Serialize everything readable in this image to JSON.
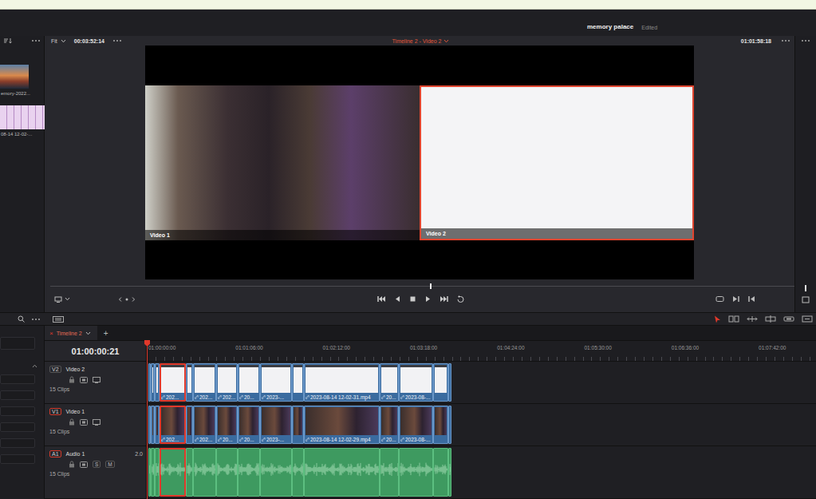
{
  "project": {
    "name": "memory palace",
    "status": "Edited"
  },
  "media_pool": {
    "items": [
      {
        "label": "emory-2022...",
        "kind": "photo"
      },
      {
        "label": "08-14 12-02-...",
        "kind": "screen"
      }
    ]
  },
  "viewer": {
    "zoom": "Fit",
    "source_timecode": "00:03:52:14",
    "title": "Timeline 2 - Video 2",
    "record_timecode": "01:01:58:18",
    "level": 0.51,
    "angles": [
      {
        "label": "Video 1",
        "kind": "camera",
        "selected": false
      },
      {
        "label": "Video 2",
        "kind": "screen",
        "selected": true
      }
    ]
  },
  "timeline": {
    "tab": {
      "label": "Timeline 2",
      "close": "×",
      "add": "+"
    },
    "timecode": "01:00:00:21",
    "ruler": [
      "01:00:00:00",
      "01:01:06:00",
      "01:02:12:00",
      "01:03:18:00",
      "01:04:24:00",
      "01:05:30:00",
      "01:06:36:00",
      "01:07:42:00"
    ],
    "tracks": [
      {
        "id": "V2",
        "name": "Video 2",
        "count": "15 Clips",
        "kind": "video",
        "targeted": false,
        "clips": [
          {
            "selected": false
          },
          {
            "selected": false
          },
          {
            "selected": false
          },
          {
            "label": "202...",
            "selected": true
          },
          {
            "selected": false
          },
          {
            "label": "202...",
            "selected": false
          },
          {
            "label": "202...",
            "selected": false
          },
          {
            "label": "20...",
            "selected": false
          },
          {
            "label": "2023-...",
            "selected": false
          },
          {
            "selected": false
          },
          {
            "label": "2023-08-14 12-02-31.mp4",
            "selected": false
          },
          {
            "label": "20...",
            "selected": false
          },
          {
            "label": "2023-08-...",
            "selected": false
          },
          {
            "selected": false
          },
          {
            "selected": false
          }
        ]
      },
      {
        "id": "V1",
        "name": "Video 1",
        "count": "15 Clips",
        "kind": "video",
        "targeted": true,
        "clips": [
          {
            "selected": false
          },
          {
            "selected": false
          },
          {
            "selected": false
          },
          {
            "label": "202...",
            "selected": true
          },
          {
            "selected": false
          },
          {
            "label": "202...",
            "selected": false
          },
          {
            "label": "20...",
            "selected": false
          },
          {
            "label": "20...",
            "selected": false
          },
          {
            "label": "2023-...",
            "selected": false
          },
          {
            "selected": false
          },
          {
            "label": "2023-08-14 12-02-29.mp4",
            "selected": false
          },
          {
            "label": "20...",
            "selected": false
          },
          {
            "label": "2023-08-...",
            "selected": false
          },
          {
            "selected": false
          },
          {
            "selected": false
          }
        ]
      },
      {
        "id": "A1",
        "name": "Audio 1",
        "channels": "2.0",
        "count": "15 Clips",
        "kind": "audio",
        "targeted": true,
        "buttons": [
          "S",
          "M"
        ],
        "clips": [
          {
            "selected": false
          },
          {
            "selected": false
          },
          {
            "selected": false
          },
          {
            "selected": true
          },
          {
            "selected": false
          },
          {
            "selected": false
          },
          {
            "selected": false
          },
          {
            "selected": false
          },
          {
            "selected": false
          },
          {
            "selected": false
          },
          {
            "selected": false
          },
          {
            "selected": false
          },
          {
            "selected": false
          },
          {
            "selected": false
          },
          {
            "selected": false
          }
        ]
      }
    ]
  }
}
